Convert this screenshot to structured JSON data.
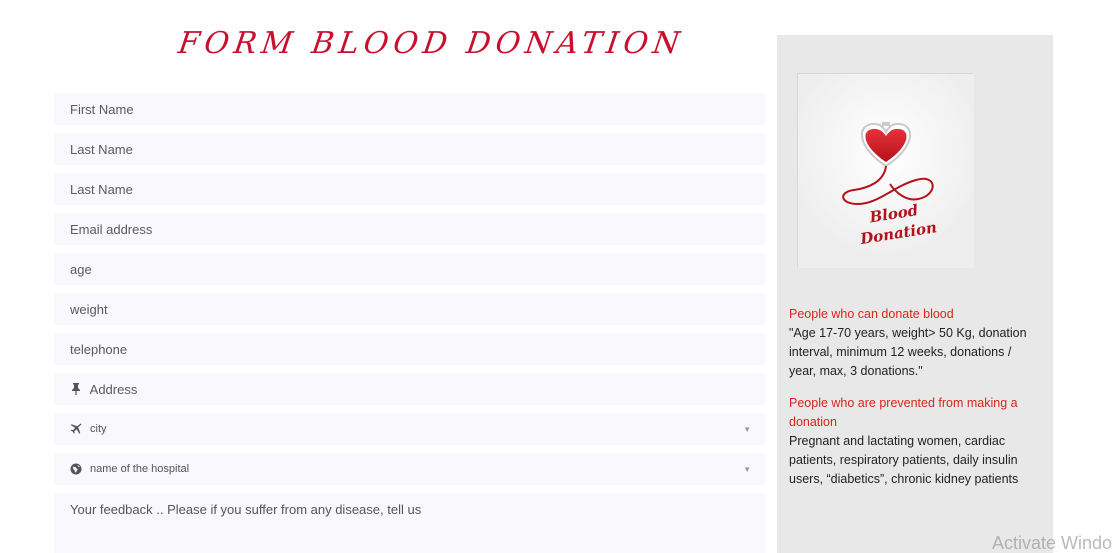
{
  "form": {
    "title": "FORM BLOOD DONATION",
    "fields": {
      "first_name": "First Name",
      "last_name": "Last Name",
      "last_name_2": "Last Name",
      "email": "Email address",
      "age": "age",
      "weight": "weight",
      "telephone": "telephone",
      "address": "Address"
    },
    "city_select": {
      "selected": "city",
      "icon": "airplane-icon"
    },
    "hospital_select": {
      "selected": "name of the hospital",
      "icon": "globe-icon"
    },
    "feedback_placeholder": "Your feedback .. Please if you suffer from any disease, tell us"
  },
  "sidebar": {
    "logo": {
      "line1": "Blood",
      "line2": "Donation",
      "icon": "heart-blood-bag-icon"
    },
    "can_donate": {
      "heading": "People who can donate blood",
      "text": "\"Age 17-70 years, weight> 50 Kg, donation interval, minimum 12 weeks, donations / year, max, 3 donations.\""
    },
    "prevented": {
      "heading": "People who are prevented from making a donation",
      "text": "Pregnant and lactating women, cardiac patients, respiratory patients, daily insulin users, “diabetics”, chronic kidney patients"
    }
  },
  "overlay": {
    "watermark": "Activate Windo"
  },
  "colors": {
    "accent": "#c8102e",
    "field_bg": "#f8f8fd",
    "sidebar_bg": "#e8e8e8"
  }
}
